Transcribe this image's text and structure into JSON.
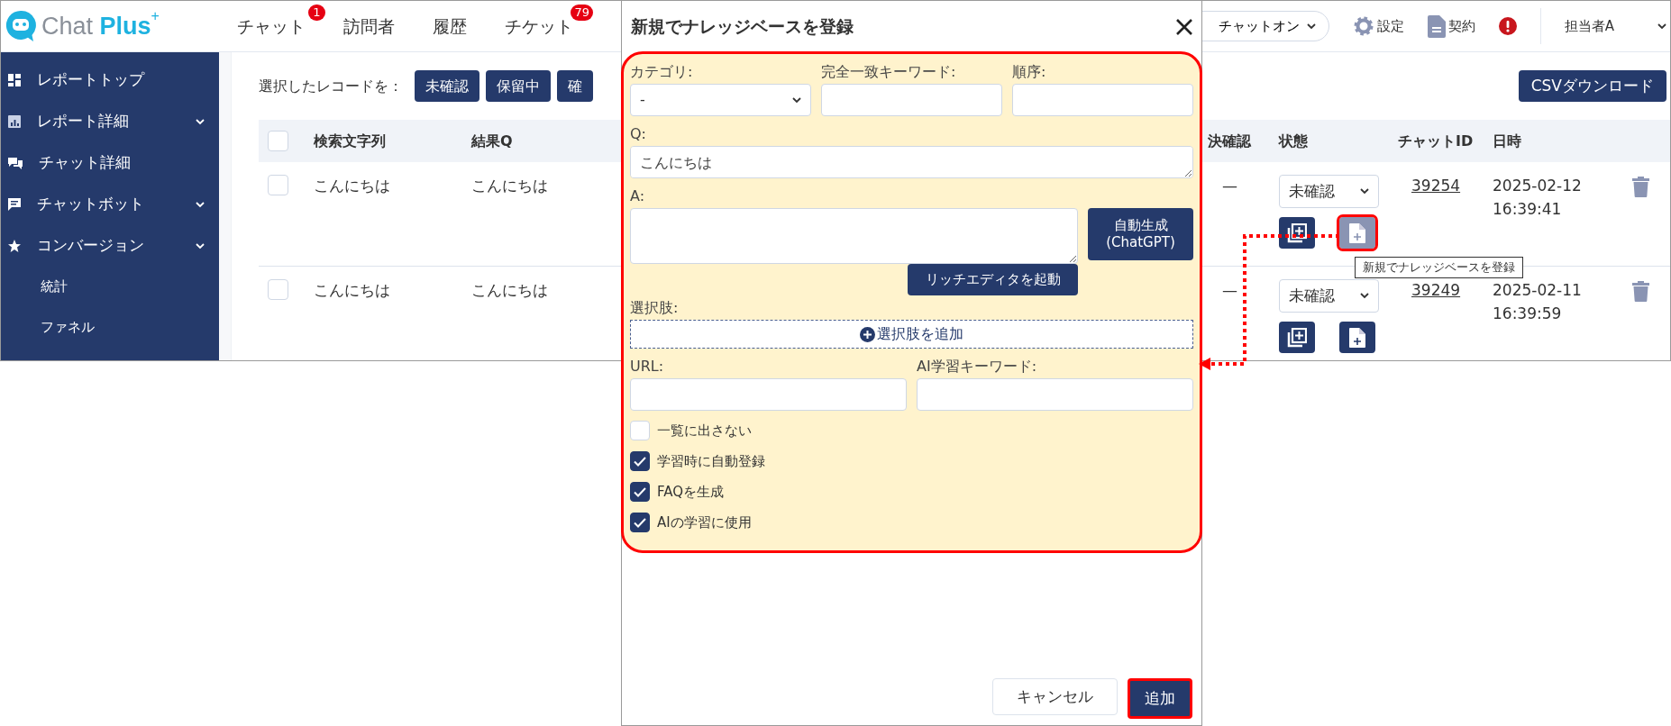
{
  "app": {
    "logo": {
      "word_1": "Chat",
      "word_2": "Plus",
      "superscript": "+"
    },
    "nav": [
      {
        "label": "チャット",
        "badge": "1"
      },
      {
        "label": "訪問者"
      },
      {
        "label": "履歴"
      },
      {
        "label": "チケット",
        "badge": "79"
      }
    ],
    "status_toggle": {
      "label": "チャットオン"
    },
    "header_links": [
      {
        "kind": "settings",
        "label": "設定"
      },
      {
        "kind": "contract",
        "label": "契約"
      },
      {
        "kind": "alert"
      }
    ],
    "user": {
      "name": "担当者A"
    },
    "sidebar": {
      "items": [
        {
          "label": "レポートトップ",
          "expandable": false
        },
        {
          "label": "レポート詳細",
          "expandable": true
        },
        {
          "label": "チャット詳細",
          "expandable": false
        },
        {
          "label": "チャットボット",
          "expandable": true
        },
        {
          "label": "コンバージョン",
          "expandable": true,
          "children": [
            {
              "label": "統計"
            },
            {
              "label": "ファネル"
            }
          ]
        }
      ]
    },
    "toolbar": {
      "label": "選択したレコードを：",
      "status_buttons": [
        "未確認",
        "保留中",
        "確"
      ],
      "export_button": "CSVダウンロード"
    },
    "table": {
      "select_all": {
        "checked": false
      },
      "columns": [
        "検索文字列",
        "結果Q",
        "決確認",
        "状態",
        "チャットID",
        "日時"
      ],
      "rows": [
        {
          "checked": false,
          "search_text": "こんにちは",
          "result_q": "こんにちは",
          "resolved": "—",
          "status": "未確認",
          "actions": [
            {
              "kind": "copy",
              "hovered": false,
              "highlighted": false
            },
            {
              "kind": "knowledge",
              "hovered": true,
              "highlighted": true,
              "tooltip": "新規でナレッジベースを登録"
            }
          ],
          "chat_id": "39254",
          "datetime": "2025-02-12 16:39:41"
        },
        {
          "checked": false,
          "search_text": "こんにちは",
          "result_q": "こんにちは",
          "resolved": "—",
          "status": "未確認",
          "actions": [
            {
              "kind": "copy",
              "hovered": false,
              "highlighted": false
            },
            {
              "kind": "knowledge",
              "hovered": false,
              "highlighted": false
            }
          ],
          "chat_id": "39249",
          "datetime": "2025-02-11 16:39:59"
        }
      ]
    }
  },
  "modal": {
    "title": "新規でナレッジベースを登録",
    "highlighted": true,
    "top_fields": [
      {
        "label": "カテゴリ:",
        "kind": "select",
        "value": "-"
      },
      {
        "label": "完全一致キーワード:",
        "kind": "input"
      },
      {
        "label": "順序:",
        "kind": "input"
      }
    ],
    "question": {
      "label": "Q:",
      "value": "こんにちは"
    },
    "answer": {
      "label": "A:"
    },
    "generate_button": "自動生成\n(ChatGPT)",
    "rich_editor_button": "リッチエディタを起動",
    "choices": {
      "label": "選択肢:",
      "add_button": "選択肢を追加"
    },
    "bottom_fields": [
      {
        "label": "URL:",
        "kind": "input"
      },
      {
        "label": "AI学習キーワード:",
        "kind": "input"
      }
    ],
    "checkboxes": [
      {
        "label": "一覧に出さない",
        "checked": false
      },
      {
        "label": "学習時に自動登録",
        "checked": true
      },
      {
        "label": "FAQを生成",
        "checked": true
      },
      {
        "label": "AIの学習に使用",
        "checked": true
      }
    ],
    "cancel_button": "キャンセル",
    "submit_button": {
      "label": "追加",
      "highlighted": true
    }
  }
}
